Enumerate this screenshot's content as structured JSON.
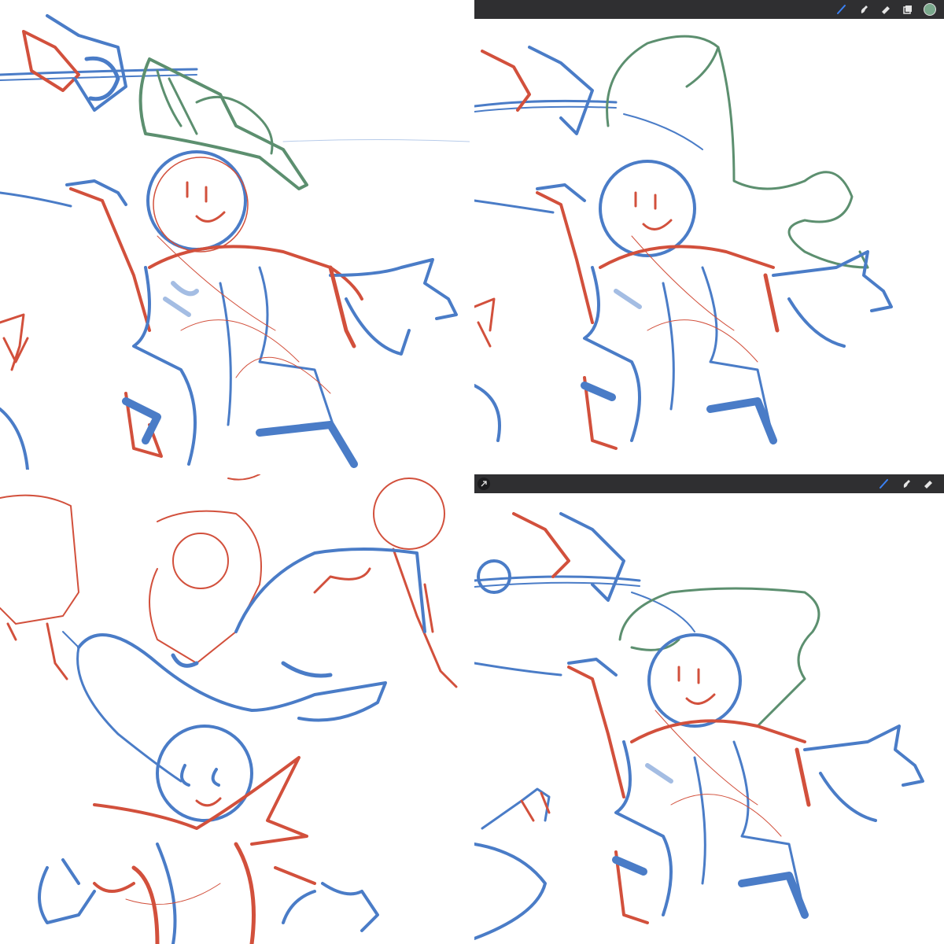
{
  "colors": {
    "blue_line": "#4a7cc7",
    "red_line": "#d2503c",
    "green_line": "#5c8f6f",
    "toolbar_bg": "#2f2f31",
    "active_tool": "#3b82f6",
    "swatch": "#7aa88c"
  },
  "toolbar_top_right": {
    "tools": [
      "brush-icon",
      "smudge-icon",
      "eraser-icon",
      "layers-icon"
    ],
    "active": "brush-icon"
  },
  "toolbar_bottom_right": {
    "tools": [
      "brush-icon",
      "smudge-icon",
      "eraser-icon"
    ],
    "active": "brush-icon",
    "left_tool": "modify-arrow-icon"
  }
}
